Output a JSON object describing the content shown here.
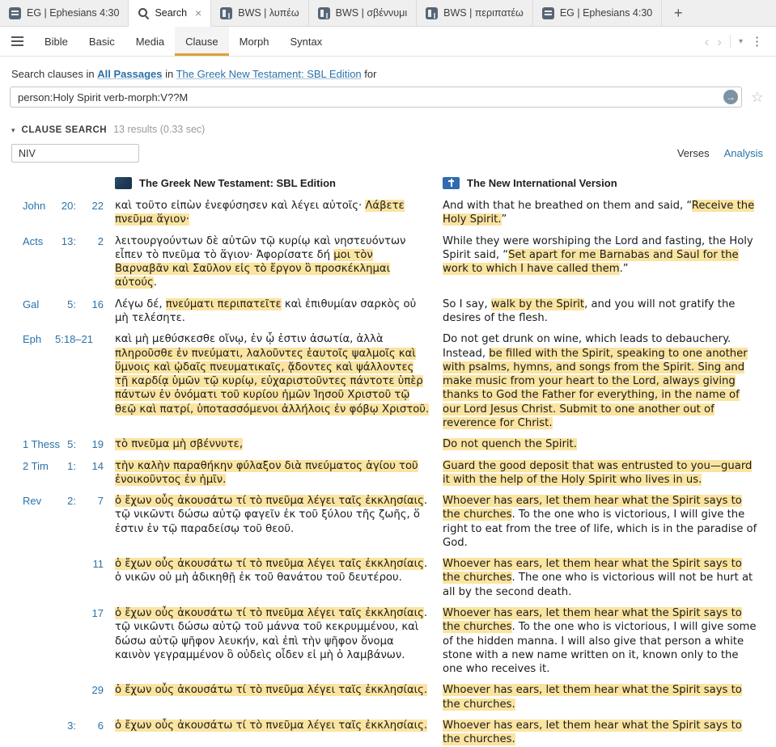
{
  "colors": {
    "highlight": "#fbe4a0",
    "link_blue": "#2a72a8",
    "accent_amber": "#dfa136"
  },
  "tabs": {
    "items": [
      {
        "icon": "guide-icon",
        "label": "EG | Ephesians 4:30",
        "active": false,
        "closable": false
      },
      {
        "icon": "search-icon",
        "label": "Search",
        "active": true,
        "closable": true
      },
      {
        "icon": "word-study-icon",
        "label": "BWS | λυπέω",
        "active": false,
        "closable": false
      },
      {
        "icon": "word-study-icon",
        "label": "BWS | σβέννυμι",
        "active": false,
        "closable": false
      },
      {
        "icon": "word-study-icon",
        "label": "BWS | περιπατέω",
        "active": false,
        "closable": false
      },
      {
        "icon": "guide-icon",
        "label": "EG | Ephesians 4:30",
        "active": false,
        "closable": false
      }
    ],
    "close_glyph": "×",
    "new_tab_label": "+"
  },
  "menubar": {
    "items": [
      {
        "label": "Bible",
        "active": false
      },
      {
        "label": "Basic",
        "active": false
      },
      {
        "label": "Media",
        "active": false
      },
      {
        "label": "Clause",
        "active": true
      },
      {
        "label": "Morph",
        "active": false
      },
      {
        "label": "Syntax",
        "active": false
      }
    ],
    "back_glyph": "‹",
    "forward_glyph": "›",
    "caret_glyph": "▾",
    "kebab_glyph": "⋮"
  },
  "search_scope": {
    "prefix": "Search clauses in",
    "scope_link": "All Passages",
    "middle": "in",
    "resource_link": "The Greek New Testament: SBL Edition",
    "suffix": "for"
  },
  "search": {
    "query": "person:Holy Spirit verb-morph:V??M",
    "go_glyph": "→",
    "star_glyph": "☆"
  },
  "results": {
    "disclosure_glyph": "▾",
    "section_title": "CLAUSE SEARCH",
    "count_text": "13 results (0.33 sec)",
    "version_filter": "NIV",
    "view_verses": "Verses",
    "view_analysis": "Analysis"
  },
  "table": {
    "left_title": "The Greek New Testament: SBL Edition",
    "right_title": "The New International Version",
    "rows": [
      {
        "book": "John",
        "chap": "20:",
        "verse": "22",
        "greek": [
          {
            "t": "καὶ τοῦτο εἰπὼν ἐνεφύσησεν καὶ λέγει αὐτοῖς· ",
            "h": false
          },
          {
            "t": "Λάβετε πνεῦμα ἅγιον·",
            "h": true
          }
        ],
        "english": [
          {
            "t": "And with that he breathed on them and said, “",
            "h": false
          },
          {
            "t": "Receive the Holy Spirit.",
            "h": true
          },
          {
            "t": "”",
            "h": false
          }
        ]
      },
      {
        "book": "Acts",
        "chap": "13:",
        "verse": "2",
        "greek": [
          {
            "t": "λειτουργούντων δὲ αὐτῶν τῷ κυρίῳ καὶ νηστευόντων εἶπεν τὸ πνεῦμα τὸ ἅγιον· Ἀφορίσατε δή ",
            "h": false
          },
          {
            "t": "μοι τὸν Βαρναβᾶν καὶ Σαῦλον εἰς τὸ ἔργον ὃ προσκέκλημαι αὐτούς",
            "h": true
          },
          {
            "t": ".",
            "h": false
          }
        ],
        "english": [
          {
            "t": "While they were worshiping the Lord and fasting, the Holy Spirit said, “",
            "h": false
          },
          {
            "t": "Set apart for me Barnabas and Saul for the work to which I have called them",
            "h": true
          },
          {
            "t": ".”",
            "h": false
          }
        ]
      },
      {
        "book": "Gal",
        "chap": "5:",
        "verse": "16",
        "greek": [
          {
            "t": "Λέγω δέ, ",
            "h": false
          },
          {
            "t": "πνεύματι περιπατεῖτε",
            "h": true
          },
          {
            "t": " καὶ ἐπιθυμίαν σαρκὸς οὐ μὴ τελέσητε.",
            "h": false
          }
        ],
        "english": [
          {
            "t": "So I say, ",
            "h": false
          },
          {
            "t": "walk by the Spirit",
            "h": true
          },
          {
            "t": ", and you will not gratify the desires of the flesh.",
            "h": false
          }
        ]
      },
      {
        "book": "Eph",
        "chap": "5:18–21",
        "verse": "",
        "greek": [
          {
            "t": "καὶ μὴ μεθύσκεσθε οἴνῳ, ἐν ᾧ ἐστιν ἀσωτία, ἀλλὰ ",
            "h": false
          },
          {
            "t": "πληροῦσθε ἐν πνεύματι, λαλοῦντες ἑαυτοῖς ψαλμοῖς καὶ ὕμνοις καὶ ᾠδαῖς πνευματικαῖς, ᾄδοντες καὶ ψάλλοντες τῇ καρδίᾳ ὑμῶν τῷ κυρίῳ, εὐχαριστοῦντες πάντοτε ὑπὲρ πάντων ἐν ὀνόματι τοῦ κυρίου ἡμῶν Ἰησοῦ Χριστοῦ τῷ θεῷ καὶ πατρί, ὑποτασσόμενοι ἀλλήλοις ἐν φόβῳ Χριστοῦ.",
            "h": true
          }
        ],
        "english": [
          {
            "t": "Do not get drunk on wine, which leads to debauchery. Instead, ",
            "h": false
          },
          {
            "t": "be filled with the Spirit, speaking to one another with psalms, hymns, and songs from the Spirit. Sing and make music from your heart to the Lord, always giving thanks to God the Father for everything, in the name of our Lord Jesus Christ. Submit to one another out of reverence for Christ.",
            "h": true
          }
        ]
      },
      {
        "book": "1 Thess",
        "chap": "5:",
        "verse": "19",
        "greek": [
          {
            "t": "τὸ πνεῦμα μὴ σβέννυτε,",
            "h": true
          }
        ],
        "english": [
          {
            "t": "Do not quench the Spirit.",
            "h": true
          }
        ]
      },
      {
        "book": "2 Tim",
        "chap": "1:",
        "verse": "14",
        "greek": [
          {
            "t": "τὴν καλὴν παραθήκην φύλαξον διὰ πνεύματος ἁγίου τοῦ ἐνοικοῦντος ἐν ἡμῖν.",
            "h": true
          }
        ],
        "english": [
          {
            "t": "Guard the good deposit that was entrusted to you—guard it with the help of the Holy Spirit who lives in us.",
            "h": true
          }
        ]
      },
      {
        "book": "Rev",
        "chap": "2:",
        "verse": "7",
        "greek": [
          {
            "t": "ὁ ἔχων οὖς ἀκουσάτω τί τὸ πνεῦμα λέγει ταῖς ἐκκλησίαις",
            "h": true
          },
          {
            "t": ". τῷ νικῶντι δώσω αὐτῷ φαγεῖν ἐκ τοῦ ξύλου τῆς ζωῆς, ὅ ἐστιν ἐν τῷ παραδείσῳ τοῦ θεοῦ.",
            "h": false
          }
        ],
        "english": [
          {
            "t": "Whoever has ears, let them hear what the Spirit says to the churches",
            "h": true
          },
          {
            "t": ". To the one who is victorious, I will give the right to eat from the tree of life, which is in the paradise of God.",
            "h": false
          }
        ]
      },
      {
        "book": "",
        "chap": "",
        "verse": "11",
        "greek": [
          {
            "t": "ὁ ἔχων οὖς ἀκουσάτω τί τὸ πνεῦμα λέγει ταῖς ἐκκλησίαις",
            "h": true
          },
          {
            "t": ". ὁ νικῶν οὐ μὴ ἀδικηθῇ ἐκ τοῦ θανάτου τοῦ δευτέρου.",
            "h": false
          }
        ],
        "english": [
          {
            "t": "Whoever has ears, let them hear what the Spirit says to the churches",
            "h": true
          },
          {
            "t": ". The one who is victorious will not be hurt at all by the second death.",
            "h": false
          }
        ]
      },
      {
        "book": "",
        "chap": "",
        "verse": "17",
        "greek": [
          {
            "t": "ὁ ἔχων οὖς ἀκουσάτω τί τὸ πνεῦμα λέγει ταῖς ἐκκλησίαις",
            "h": true
          },
          {
            "t": ". τῷ νικῶντι δώσω αὐτῷ τοῦ μάννα τοῦ κεκρυμμένου, καὶ δώσω αὐτῷ ψῆφον λευκήν, καὶ ἐπὶ τὴν ψῆφον ὄνομα καινὸν γεγραμμένον ὃ οὐδεὶς οἶδεν εἰ μὴ ὁ λαμβάνων.",
            "h": false
          }
        ],
        "english": [
          {
            "t": "Whoever has ears, let them hear what the Spirit says to the churches",
            "h": true
          },
          {
            "t": ". To the one who is victorious, I will give some of the hidden manna. I will also give that person a white stone with a new name written on it, known only to the one who receives it.",
            "h": false
          }
        ]
      },
      {
        "book": "",
        "chap": "",
        "verse": "29",
        "greek": [
          {
            "t": "ὁ ἔχων οὖς ἀκουσάτω τί τὸ πνεῦμα λέγει ταῖς ἐκκλησίαις.",
            "h": true
          }
        ],
        "english": [
          {
            "t": "Whoever has ears, let them hear what the Spirit says to the churches.",
            "h": true
          }
        ]
      },
      {
        "book": "",
        "chap": "3:",
        "verse": "6",
        "greek": [
          {
            "t": "ὁ ἔχων οὖς ἀκουσάτω τί τὸ πνεῦμα λέγει ταῖς ἐκκλησίαις.",
            "h": true
          }
        ],
        "english": [
          {
            "t": "Whoever has ears, let them hear what the Spirit says to the churches.",
            "h": true
          }
        ]
      }
    ]
  }
}
